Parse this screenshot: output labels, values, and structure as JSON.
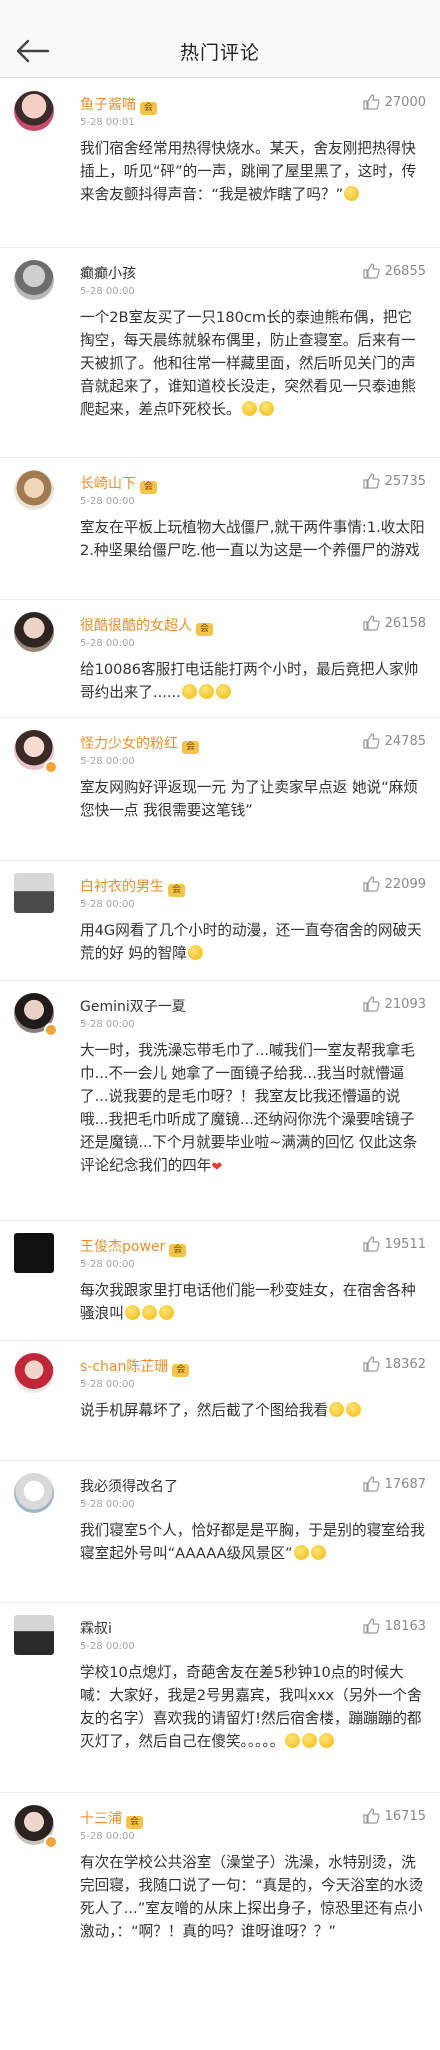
{
  "header": {
    "title": "热门评论"
  },
  "comments": [
    {
      "user": "鱼子酱喵",
      "time": "5-28 00:01",
      "likes": "27000",
      "text": "我们宿舍经常用热得快烧水。某天，舍友刚把热得快插上，听见“砰”的一声，跳闸了屋里黑了，这时，传来舍友颤抖得声音：“我是被炸瞎了吗？”"
    },
    {
      "user": "癫癫小孩",
      "time": "5-28 00:00",
      "likes": "26855",
      "text": "一个2B室友买了一只180cm长的泰迪熊布偶，把它掏空，每天晨练就躲布偶里，防止查寝室。后来有一天被抓了。他和往常一样藏里面，然后听见关门的声音就起来了，谁知道校长没走，突然看见一只泰迪熊爬起来，差点吓死校长。"
    },
    {
      "user": "长崎山下",
      "time": "5-28 00:00",
      "likes": "25735",
      "text": "室友在平板上玩植物大战僵尸,就干两件事情:1.收太阳 2.种坚果给僵尸吃.他一直以为这是一个养僵尸的游戏"
    },
    {
      "user": "很酷很酷的女超人",
      "time": "5-28 00:00",
      "likes": "26158",
      "text": "给10086客服打电话能打两个小时，最后竟把人家帅哥约出来了......"
    },
    {
      "user": "怪力少女的粉红",
      "time": "5-28 00:00",
      "likes": "24785",
      "text": "室友网购好评返现一元 为了让卖家早点返 她说“麻烦您快一点 我很需要这笔钱”"
    },
    {
      "user": "白衬衣的男生",
      "time": "5-28 00:00",
      "likes": "22099",
      "text": "用4G网看了几个小时的动漫，还一直夸宿舍的网破天荒的好 妈的智障"
    },
    {
      "user": "Gemini双子一夏",
      "time": "5-28 00:00",
      "likes": "21093",
      "text": "大一时，我洗澡忘带毛巾了...喊我们一室友帮我拿毛巾...不一会儿 她拿了一面镜子给我...我当时就懵逼了...说我要的是毛巾呀？！我室友比我还懵逼的说 哦...我把毛巾听成了魔镜...还纳闷你洗个澡要啥镜子还是魔镜...下个月就要毕业啦~满满的回忆 仅此这条评论纪念我们的四年"
    },
    {
      "user": "王俊杰power",
      "time": "5-28 00:00",
      "likes": "19511",
      "text": "每次我跟家里打电话他们能一秒变娃女，在宿舍各种骚浪叫"
    },
    {
      "user": "s-chan陈芷珊",
      "time": "5-28 00:00",
      "likes": "18362",
      "text": "说手机屏幕坏了，然后截了个图给我看"
    },
    {
      "user": "我必须得改名了",
      "time": "5-28 00:00",
      "likes": "17687",
      "text": "我们寝室5个人，恰好都是是平胸，于是别的寝室给我寝室起外号叫“AAAAA级风景区”"
    },
    {
      "user": "霖叔i",
      "time": "5-28 00:00",
      "likes": "18163",
      "text": "学校10点熄灯，奇葩舍友在差5秒钟10点的时候大喊：大家好，我是2号男嘉宾，我叫xxx（另外一个舍友的名字）喜欢我的请留灯!然后宿舍楼，蹦蹦蹦的都灭灯了，然后自己在傻笑。。。。。"
    },
    {
      "user": "十三浦",
      "time": "5-28 00:00",
      "likes": "16715",
      "text": "有次在学校公共浴室（澡堂子）洗澡，水特别烫，洗完回寝，我随口说了一句：“真是的，今天浴室的水烫死人了...”室友噌的从床上探出身子，惊恐里还有点小激动，：“啊？！真的吗？谁呀谁呀？？”"
    }
  ]
}
